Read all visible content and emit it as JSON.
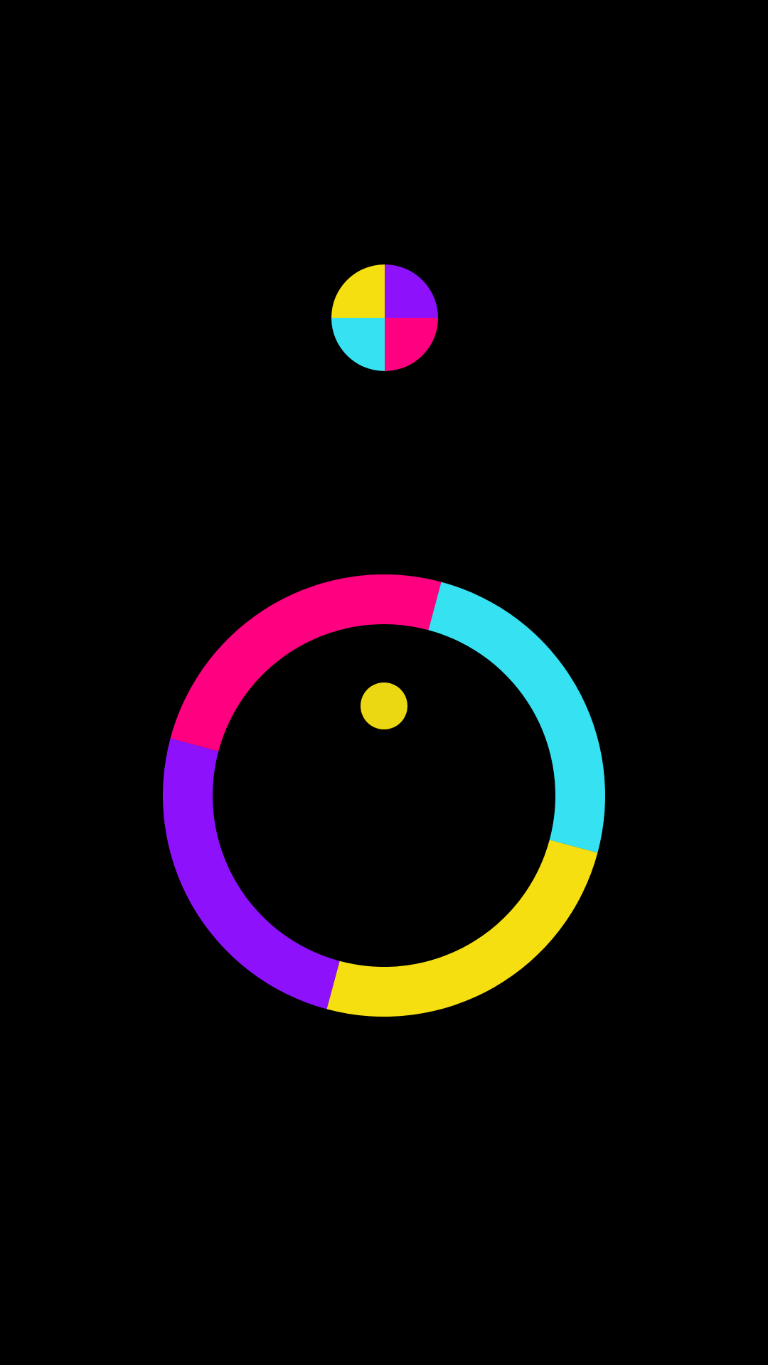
{
  "game": {
    "background_color": "#000000",
    "colors": {
      "cyan": "#36E2F2",
      "yellow": "#F5DF11",
      "purple": "#8E11FC",
      "magenta": "#FF0080",
      "ball": "#EBD813"
    },
    "color_switcher": {
      "icon": "color-switcher-icon",
      "quadrants": [
        {
          "position": "top-left",
          "color": "yellow"
        },
        {
          "position": "top-right",
          "color": "purple"
        },
        {
          "position": "bottom-right",
          "color": "magenta"
        },
        {
          "position": "bottom-left",
          "color": "cyan"
        }
      ]
    },
    "ring_obstacle": {
      "segments": [
        {
          "color": "cyan",
          "share": 0.25
        },
        {
          "color": "yellow",
          "share": 0.25
        },
        {
          "color": "purple",
          "share": 0.25
        },
        {
          "color": "magenta",
          "share": 0.25
        }
      ]
    },
    "player_ball": {
      "color": "ball"
    }
  }
}
